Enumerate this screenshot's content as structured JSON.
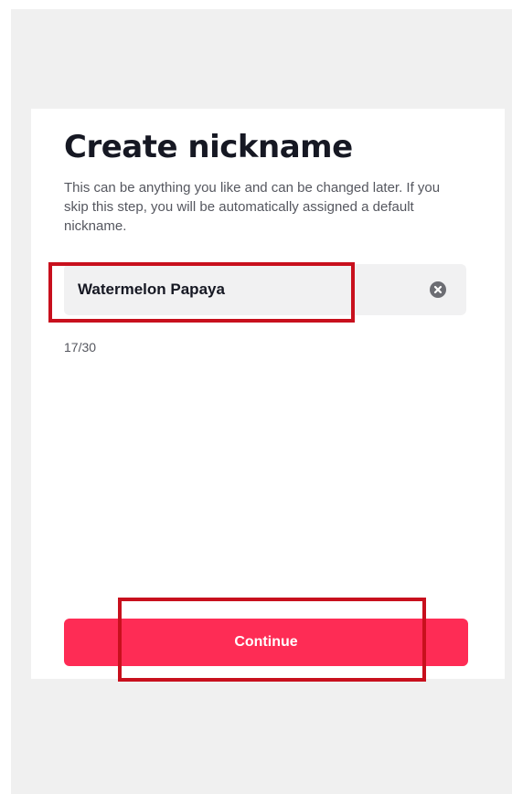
{
  "screen": {
    "title": "Create nickname",
    "description": "This can be anything you like and can be changed later. If you skip this step, you will be automatically assigned a default nickname."
  },
  "nickname_field": {
    "value": "Watermelon Papaya",
    "clear_icon": "clear-x-circle-icon",
    "char_counter": "17/30"
  },
  "actions": {
    "continue_label": "Continue"
  },
  "colors": {
    "accent": "#fe2c55",
    "highlight": "#c8101d",
    "field_bg": "#f1f1f2",
    "backdrop": "#f0f0f0"
  }
}
